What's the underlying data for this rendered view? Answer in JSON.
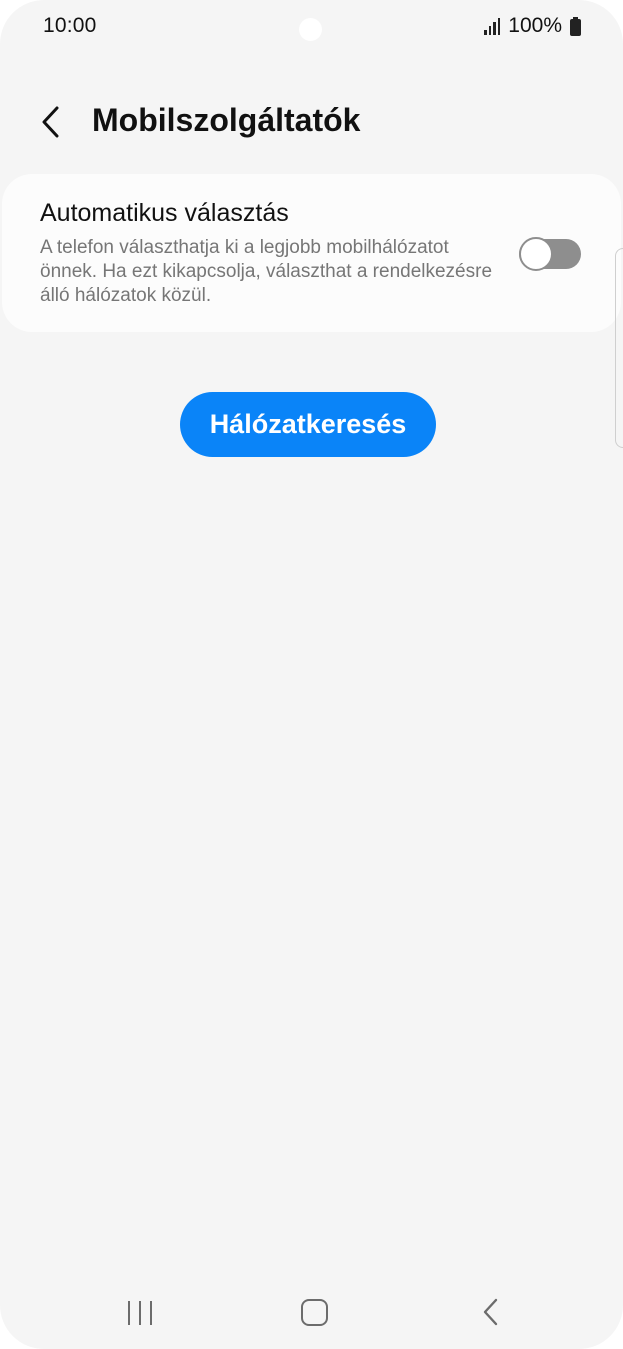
{
  "status_bar": {
    "time": "10:00",
    "battery": "100%",
    "signal_icon": "signal-icon",
    "battery_icon": "battery-icon"
  },
  "header": {
    "title": "Mobilszolgáltatók",
    "back_icon": "chevron-left-icon"
  },
  "settings": {
    "auto_select": {
      "title": "Automatikus választás",
      "description": "A telefon választhatja ki a legjobb mobilhálózatot önnek. Ha ezt kikapcsolja, választhat a rendelkezésre álló hálózatok közül.",
      "enabled": false
    }
  },
  "actions": {
    "search_label": "Hálózatkeresés",
    "accent_color": "#0a84f8"
  },
  "nav_bar": {
    "recents_icon": "recents-icon",
    "home_icon": "home-icon",
    "back_icon": "back-icon"
  }
}
